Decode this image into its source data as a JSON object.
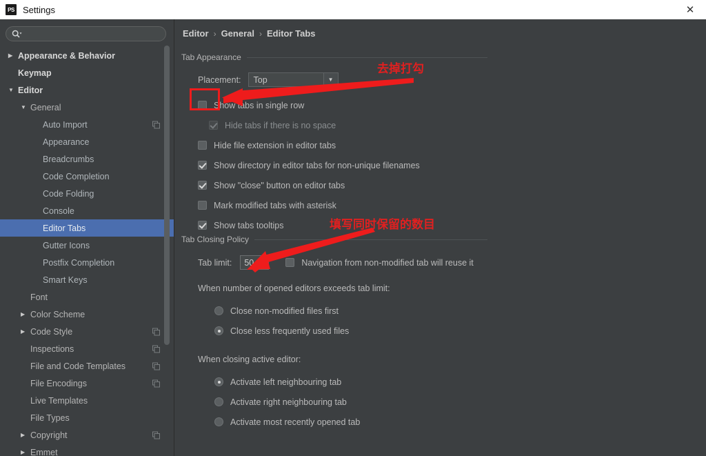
{
  "window": {
    "title": "Settings",
    "app_icon": "PS",
    "close_icon": "✕"
  },
  "sidebar": {
    "search": {
      "placeholder": "",
      "value": "",
      "icon": "search-icon"
    },
    "items": [
      {
        "label": "Appearance & Behavior",
        "level": 0,
        "arrow": "▶",
        "style": "top",
        "copy": false,
        "selected": false
      },
      {
        "label": "Keymap",
        "level": 0,
        "arrow": "",
        "style": "top",
        "copy": false,
        "selected": false
      },
      {
        "label": "Editor",
        "level": 0,
        "arrow": "▼",
        "style": "top",
        "copy": false,
        "selected": false
      },
      {
        "label": "General",
        "level": 1,
        "arrow": "▼",
        "style": "mid",
        "copy": false,
        "selected": false
      },
      {
        "label": "Auto Import",
        "level": 2,
        "arrow": "",
        "style": "leaf",
        "copy": true,
        "selected": false
      },
      {
        "label": "Appearance",
        "level": 2,
        "arrow": "",
        "style": "leaf",
        "copy": false,
        "selected": false
      },
      {
        "label": "Breadcrumbs",
        "level": 2,
        "arrow": "",
        "style": "leaf",
        "copy": false,
        "selected": false
      },
      {
        "label": "Code Completion",
        "level": 2,
        "arrow": "",
        "style": "leaf",
        "copy": false,
        "selected": false
      },
      {
        "label": "Code Folding",
        "level": 2,
        "arrow": "",
        "style": "leaf",
        "copy": false,
        "selected": false
      },
      {
        "label": "Console",
        "level": 2,
        "arrow": "",
        "style": "leaf",
        "copy": false,
        "selected": false
      },
      {
        "label": "Editor Tabs",
        "level": 2,
        "arrow": "",
        "style": "leaf",
        "copy": false,
        "selected": true
      },
      {
        "label": "Gutter Icons",
        "level": 2,
        "arrow": "",
        "style": "leaf",
        "copy": false,
        "selected": false
      },
      {
        "label": "Postfix Completion",
        "level": 2,
        "arrow": "",
        "style": "leaf",
        "copy": false,
        "selected": false
      },
      {
        "label": "Smart Keys",
        "level": 2,
        "arrow": "",
        "style": "leaf",
        "copy": false,
        "selected": false
      },
      {
        "label": "Font",
        "level": 1,
        "arrow": "",
        "style": "mid",
        "copy": false,
        "selected": false
      },
      {
        "label": "Color Scheme",
        "level": 1,
        "arrow": "▶",
        "style": "mid",
        "copy": false,
        "selected": false
      },
      {
        "label": "Code Style",
        "level": 1,
        "arrow": "▶",
        "style": "mid",
        "copy": true,
        "selected": false
      },
      {
        "label": "Inspections",
        "level": 1,
        "arrow": "",
        "style": "mid",
        "copy": true,
        "selected": false
      },
      {
        "label": "File and Code Templates",
        "level": 1,
        "arrow": "",
        "style": "mid",
        "copy": true,
        "selected": false
      },
      {
        "label": "File Encodings",
        "level": 1,
        "arrow": "",
        "style": "mid",
        "copy": true,
        "selected": false
      },
      {
        "label": "Live Templates",
        "level": 1,
        "arrow": "",
        "style": "mid",
        "copy": false,
        "selected": false
      },
      {
        "label": "File Types",
        "level": 1,
        "arrow": "",
        "style": "mid",
        "copy": false,
        "selected": false
      },
      {
        "label": "Copyright",
        "level": 1,
        "arrow": "▶",
        "style": "mid",
        "copy": true,
        "selected": false
      },
      {
        "label": "Emmet",
        "level": 1,
        "arrow": "▶",
        "style": "mid",
        "copy": false,
        "selected": false
      }
    ]
  },
  "main": {
    "breadcrumb": [
      "Editor",
      "General",
      "Editor Tabs"
    ],
    "breadcrumb_separator": "›",
    "tab_appearance": {
      "title": "Tab Appearance",
      "placement_label": "Placement:",
      "placement_value": "Top",
      "placement_arrow": "▼",
      "checkboxes": [
        {
          "label": "Show tabs in single row",
          "checked": false,
          "disabled": false,
          "indent": 0
        },
        {
          "label": "Hide tabs if there is no space",
          "checked": true,
          "disabled": true,
          "indent": 1
        },
        {
          "label": "Hide file extension in editor tabs",
          "checked": false,
          "disabled": false,
          "indent": 0
        },
        {
          "label": "Show directory in editor tabs for non-unique filenames",
          "checked": true,
          "disabled": false,
          "indent": 0
        },
        {
          "label": "Show \"close\" button on editor tabs",
          "checked": true,
          "disabled": false,
          "indent": 0
        },
        {
          "label": "Mark modified tabs with asterisk",
          "checked": false,
          "disabled": false,
          "indent": 0
        },
        {
          "label": "Show tabs tooltips",
          "checked": true,
          "disabled": false,
          "indent": 0
        }
      ]
    },
    "tab_closing_policy": {
      "title": "Tab Closing Policy",
      "tab_limit_label": "Tab limit:",
      "tab_limit_value": "50",
      "reuse_checkbox": {
        "label": "Navigation from non-modified tab will reuse it",
        "checked": false
      },
      "exceeds_label": "When number of opened editors exceeds tab limit:",
      "exceeds_options": [
        {
          "label": "Close non-modified files first",
          "selected": false
        },
        {
          "label": "Close less frequently used files",
          "selected": true
        }
      ],
      "closing_label": "When closing active editor:",
      "closing_options": [
        {
          "label": "Activate left neighbouring tab",
          "selected": true
        },
        {
          "label": "Activate right neighbouring tab",
          "selected": false
        },
        {
          "label": "Activate most recently opened tab",
          "selected": false
        }
      ]
    }
  },
  "annotations": {
    "color": "#ee1c1c",
    "note_1": "去掉打勾",
    "note_2": "填写同时保留的数目"
  },
  "colors": {
    "background": "#3c3f41",
    "selection": "#4b6eaf",
    "titlebar": "#ffffff",
    "annotation_red": "#ee1c1c",
    "text": "#bbbbbb"
  }
}
